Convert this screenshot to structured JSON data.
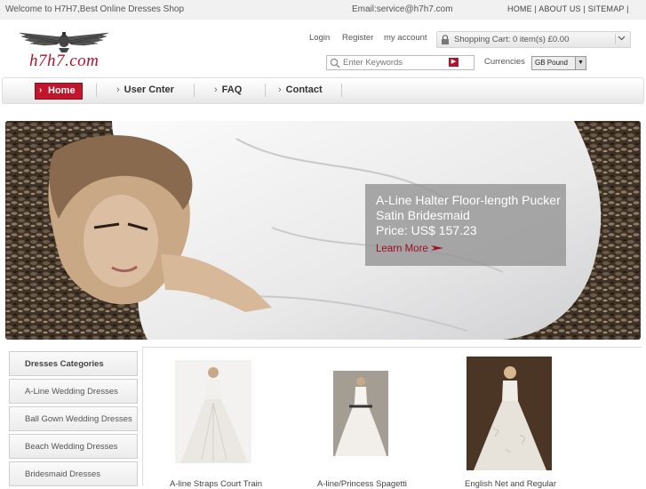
{
  "topbar": {
    "welcome": "Welcome to H7H7,Best Online Dresses Shop",
    "email": "Email:service@h7h7.com",
    "links": [
      "HOME",
      "ABOUT US",
      "SITEMAP"
    ],
    "sep": "|"
  },
  "brand": {
    "logo_text": "h7h7.com"
  },
  "account": {
    "login": "Login",
    "register": "Register",
    "my_account": "my account"
  },
  "cart": {
    "label": "Shopping Cart: 0 item(s) £0.00"
  },
  "search": {
    "placeholder": "Enter Keywords"
  },
  "currency": {
    "label": "Currencies",
    "selected": "GB Pound"
  },
  "nav": {
    "items": [
      "Home",
      "User Cnter",
      "FAQ",
      "Contact"
    ]
  },
  "promo": {
    "line1": "A-Line Halter Floor-length Pucker",
    "line2": "Satin Bridesmaid",
    "line3": "Price: US$ 157.23",
    "cta": "Learn More"
  },
  "sidebar": {
    "heading": "Dresses Categories",
    "items": [
      "A-Line Wedding Dresses",
      "Ball Gown Wedding Dresses",
      "Beach Wedding Dresses",
      "Bridesmaid Dresses"
    ]
  },
  "products": [
    {
      "name": "A-line Straps Court Train"
    },
    {
      "name": "A-line/Princess Spagetti"
    },
    {
      "name": "English Net and Regular"
    }
  ],
  "icons": {
    "lock": "lock-icon",
    "search": "search-icon",
    "chevron": "chevron-down-icon",
    "nav_arrow": "chevron-right-icon",
    "cta_arrow": "arrow-right-icon"
  },
  "colors": {
    "brand_red": "#c0152b",
    "logo_red": "#b3132a",
    "cta_red": "#9e0e20"
  }
}
